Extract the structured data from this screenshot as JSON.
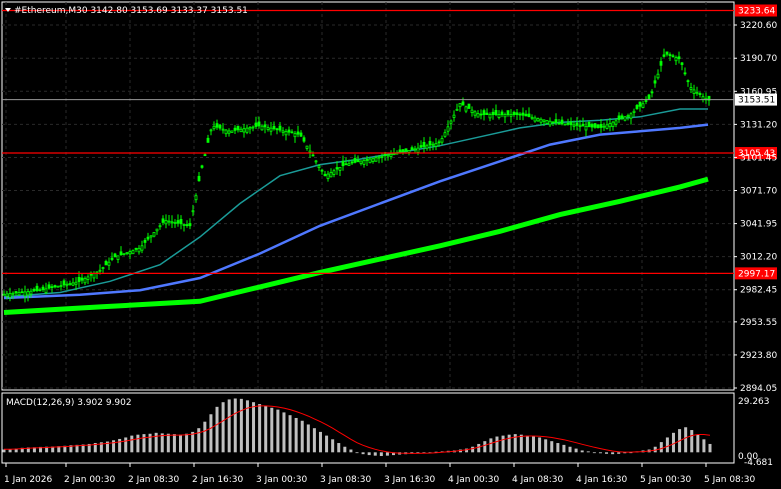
{
  "header": {
    "symbol_line": "#Ethereum,M30  3142.80 3153.69 3133.37 3153.51",
    "dropdown_icon": "triangle-down-icon"
  },
  "colors": {
    "background": "#000000",
    "grid": "#2a2a2a",
    "candle": "#00ff00",
    "ma_short": "#1a9b98",
    "ma_mid": "#4f78ff",
    "ma_long": "#00ff00",
    "level_line": "#ff0000",
    "price_tag_bg": "#ff0000",
    "macd_hist": "#c0c0c0",
    "macd_signal": "#ff0000"
  },
  "price_axis": {
    "ticks": [
      "3220.60",
      "3190.70",
      "3160.95",
      "3131.20",
      "3101.45",
      "3071.70",
      "3041.95",
      "3012.20",
      "2982.45",
      "2953.55",
      "2923.80",
      "2894.05"
    ],
    "tick_values": [
      3220.6,
      3190.7,
      3160.95,
      3131.2,
      3101.45,
      3071.7,
      3041.95,
      3012.2,
      2982.45,
      2953.55,
      2923.8,
      2894.05
    ],
    "current_price": "3153.51",
    "current_value": 3153.51
  },
  "levels": [
    {
      "label": "3233.64",
      "value": 3233.64
    },
    {
      "label": "3105.43",
      "value": 3105.43
    },
    {
      "label": "2997.17",
      "value": 2997.17
    }
  ],
  "time_axis": {
    "labels": [
      "1 Jan 2026",
      "2 Jan 00:30",
      "2 Jan 08:30",
      "2 Jan 16:30",
      "3 Jan 00:30",
      "3 Jan 08:30",
      "3 Jan 16:30",
      "4 Jan 00:30",
      "4 Jan 08:30",
      "4 Jan 16:30",
      "5 Jan 00:30",
      "5 Jan 08:30"
    ]
  },
  "macd": {
    "label": "MACD(12,26,9) 3.902 9.902",
    "axis_top": "29.263",
    "axis_zero": "0.00",
    "axis_bottom": "-4.681",
    "histogram_values": [
      1.5,
      1.8,
      2.0,
      2.4,
      2.6,
      2.7,
      2.9,
      3.0,
      3.1,
      3.3,
      3.5,
      3.8,
      4.0,
      4.2,
      4.5,
      5.0,
      5.4,
      5.8,
      6.5,
      7.2,
      8.0,
      9.0,
      9.5,
      9.8,
      10.0,
      10.5,
      10.2,
      10.0,
      9.8,
      9.5,
      10.0,
      11.0,
      13.0,
      16.5,
      20.5,
      24.5,
      27.0,
      28.5,
      29.0,
      28.8,
      28.0,
      27.0,
      26.0,
      25.0,
      24.0,
      23.0,
      21.5,
      20.0,
      18.5,
      17.0,
      15.0,
      13.0,
      11.0,
      9.0,
      7.0,
      5.0,
      3.0,
      1.5,
      0.0,
      -1.0,
      -1.5,
      -1.8,
      -2.0,
      -1.8,
      -1.5,
      -1.2,
      -1.0,
      -0.8,
      -0.5,
      -0.3,
      0.0,
      0.3,
      0.5,
      0.8,
      1.0,
      1.5,
      2.0,
      3.0,
      4.5,
      6.0,
      7.5,
      8.5,
      9.0,
      9.5,
      9.8,
      9.5,
      9.0,
      8.5,
      8.0,
      7.0,
      6.0,
      5.0,
      4.0,
      3.0,
      2.0,
      1.0,
      0.5,
      0.0,
      -0.5,
      -0.8,
      -1.0,
      -0.8,
      -0.5,
      0.0,
      0.5,
      1.0,
      1.5,
      3.0,
      5.5,
      8.0,
      10.5,
      12.5,
      13.5,
      12.0,
      9.5,
      7.0,
      4.5
    ],
    "signal_values": [
      1.6,
      1.7,
      1.8,
      2.0,
      2.2,
      2.4,
      2.5,
      2.6,
      2.8,
      2.9,
      3.1,
      3.3,
      3.5,
      3.7,
      3.9,
      4.2,
      4.5,
      4.8,
      5.2,
      5.6,
      6.1,
      6.7,
      7.3,
      7.8,
      8.2,
      8.7,
      9.0,
      9.2,
      9.3,
      9.3,
      9.5,
      9.8,
      10.5,
      11.5,
      13.0,
      15.0,
      17.0,
      19.0,
      21.0,
      22.5,
      23.8,
      24.6,
      25.0,
      25.0,
      24.8,
      24.4,
      23.8,
      23.0,
      22.0,
      20.8,
      19.5,
      18.0,
      16.5,
      14.8,
      13.0,
      11.0,
      9.0,
      7.0,
      5.2,
      3.8,
      2.6,
      1.6,
      0.8,
      0.2,
      -0.2,
      -0.4,
      -0.5,
      -0.6,
      -0.6,
      -0.5,
      -0.4,
      -0.2,
      0.0,
      0.3,
      0.6,
      1.0,
      1.4,
      2.0,
      2.8,
      3.8,
      4.8,
      5.8,
      6.8,
      7.6,
      8.2,
      8.6,
      8.8,
      8.8,
      8.7,
      8.4,
      8.0,
      7.4,
      6.8,
      6.0,
      5.2,
      4.3,
      3.5,
      2.7,
      2.0,
      1.3,
      0.7,
      0.3,
      0.1,
      0.1,
      0.2,
      0.4,
      0.7,
      1.2,
      2.0,
      3.2,
      4.6,
      6.2,
      7.8,
      9.0,
      9.6,
      9.6,
      9.2
    ]
  }
}
